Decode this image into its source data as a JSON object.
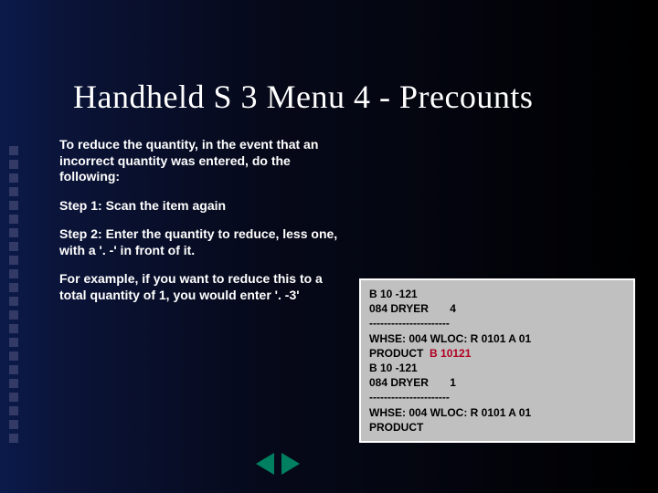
{
  "title": "Handheld S 3 Menu 4 - Precounts",
  "intro": "To reduce the quantity, in the event that an incorrect quantity was entered, do the following:",
  "step1": "Step 1: Scan the item again",
  "step2": "Step 2: Enter the quantity to reduce, less one, with a '. -' in front of it.",
  "example": "For example, if you want to reduce this to a total quantity of 1, you would enter '. -3'",
  "terminal": {
    "l1": "B 10 -121",
    "l2a": "084 DRYER",
    "l2b": "4",
    "l3": "----------------------",
    "l4": "WHSE: 004 WLOC: R 0101 A 01",
    "l5a": "PRODUCT",
    "l5b": "B 10121",
    "l6": "B 10 -121",
    "l7a": "084 DRYER",
    "l7b": "1",
    "l8": "----------------------",
    "l9": "WHSE: 004 WLOC: R 0101 A 01",
    "l10": "PRODUCT"
  },
  "nav": {
    "prev": "previous",
    "next": "next"
  }
}
